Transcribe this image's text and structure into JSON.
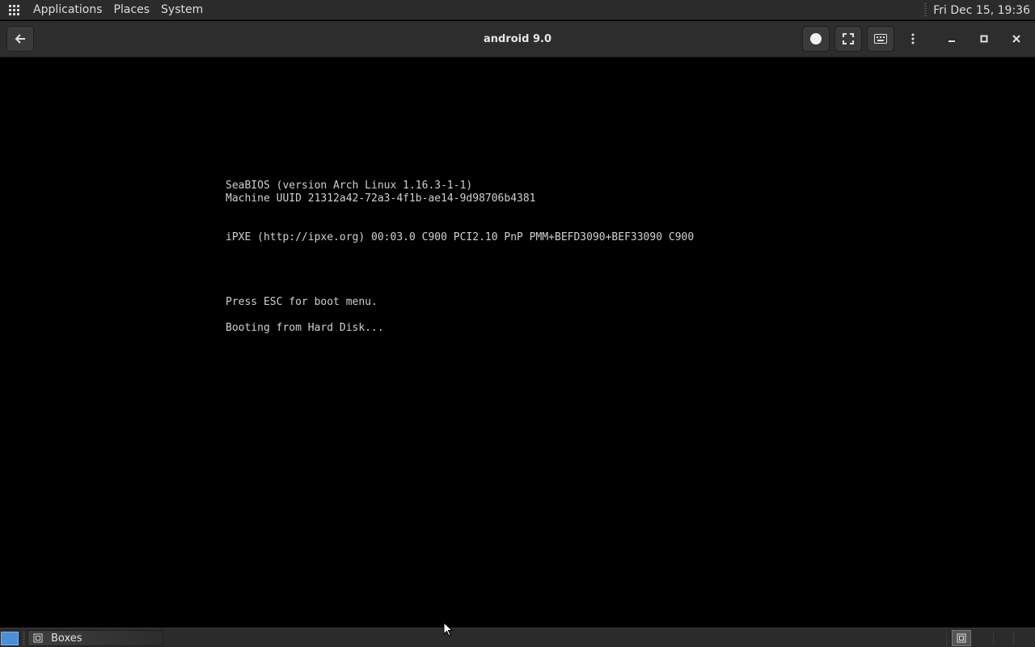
{
  "top_panel": {
    "menus": [
      "Applications",
      "Places",
      "System"
    ],
    "clock": "Fri Dec 15, 19:36"
  },
  "window": {
    "title": "android 9.0",
    "icons": {
      "back": "arrow-left-icon",
      "record": "circle-icon",
      "fullscreen": "fullscreen-icon",
      "keyboard": "keyboard-icon",
      "menu": "kebab-menu-icon",
      "minimize": "minimize-icon",
      "maximize": "maximize-icon",
      "close": "close-icon"
    }
  },
  "vm_screen": {
    "lines": {
      "bios_version": "SeaBIOS (version Arch Linux 1.16.3-1-1)",
      "machine_uuid": "Machine UUID 21312a42-72a3-4f1b-ae14-9d98706b4381",
      "ipxe": "iPXE (http://ipxe.org) 00:03.0 C900 PCI2.10 PnP PMM+BEFD3090+BEF33090 C900",
      "esc_hint": "Press ESC for boot menu.",
      "booting": "Booting from Hard Disk..."
    },
    "text_color": "#d0d0d0",
    "background": "#000000"
  },
  "bottom_panel": {
    "task": "Boxes"
  },
  "colors": {
    "panel": "#2b2b2b",
    "headerbar": "#2d2d2d",
    "accent": "#4a8fd8"
  }
}
